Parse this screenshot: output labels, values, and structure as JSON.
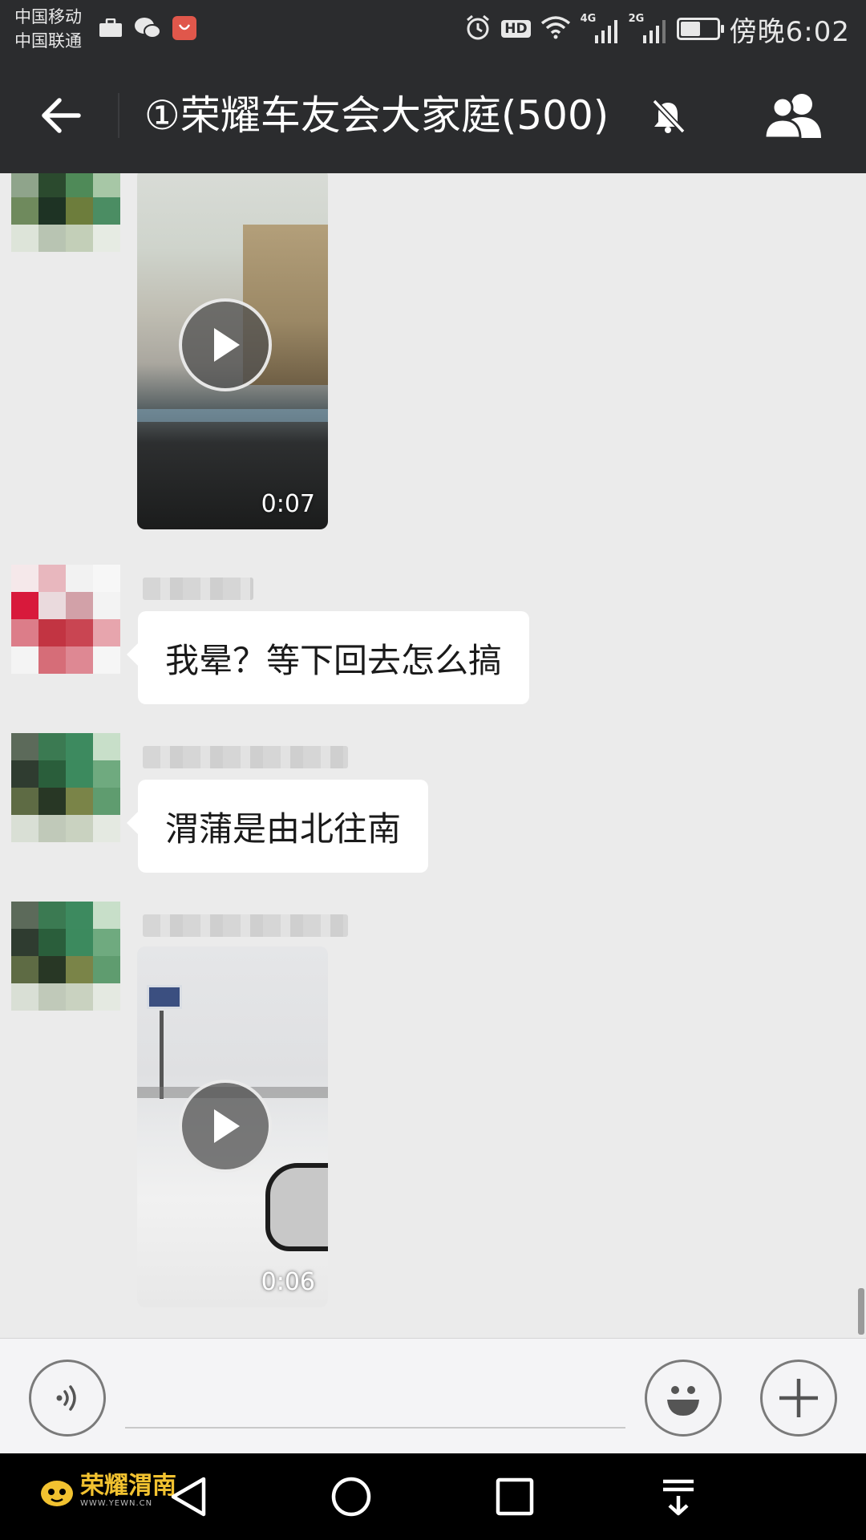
{
  "status_bar": {
    "carrier_1": "中国移动",
    "carrier_2": "中国联通",
    "hd": "HD",
    "net_1": "4G",
    "net_2": "2G",
    "battery_level": 0.55,
    "time": "傍晚6:02"
  },
  "header": {
    "title": "①荣耀车友会大家庭(500)",
    "back_icon": "arrow-left-icon",
    "mute_icon": "bell-off-icon",
    "members_icon": "group-icon"
  },
  "messages": [
    {
      "type": "video",
      "avatar": "green",
      "duration": "0:07"
    },
    {
      "type": "text",
      "avatar": "red",
      "text": "我晕？等下回去怎么搞"
    },
    {
      "type": "text",
      "avatar": "green",
      "text": "渭蒲是由北往南"
    },
    {
      "type": "video",
      "avatar": "green",
      "duration": "0:06"
    }
  ],
  "input_bar": {
    "voice_icon": "voice-icon",
    "emoji_icon": "emoji-icon",
    "plus_icon": "plus-icon"
  },
  "nav_bar": {
    "watermark": "荣耀渭南",
    "watermark_sub": "WWW.YEWN.CN"
  },
  "colors": {
    "header_bg": "#2b2c2e",
    "chat_bg": "#ebebeb",
    "bubble_bg": "#ffffff"
  }
}
